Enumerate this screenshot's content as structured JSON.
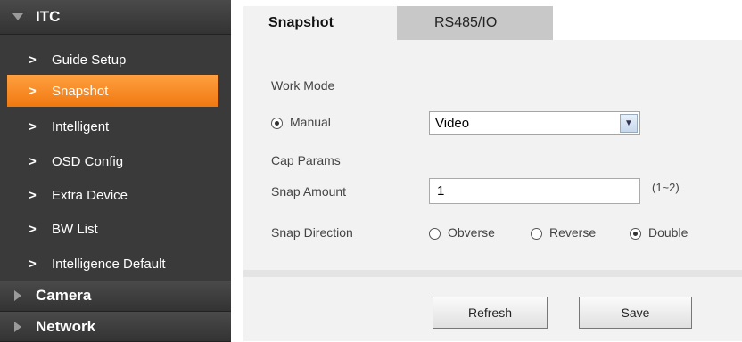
{
  "sidebar": {
    "header": "ITC",
    "items": [
      {
        "label": "Guide Setup"
      },
      {
        "label": "Snapshot",
        "active": true
      },
      {
        "label": "Intelligent"
      },
      {
        "label": "OSD Config"
      },
      {
        "label": "Extra Device"
      },
      {
        "label": "BW List"
      },
      {
        "label": "Intelligence Default"
      }
    ],
    "sections": [
      {
        "label": "Camera"
      },
      {
        "label": "Network"
      }
    ],
    "accent_color": "#f5821f"
  },
  "tabs": [
    {
      "label": "Snapshot",
      "active": true
    },
    {
      "label": "RS485/IO",
      "active": false
    }
  ],
  "form": {
    "work_mode_label": "Work Mode",
    "manual_label": "Manual",
    "mode_value": "Video",
    "cap_params_label": "Cap Params",
    "snap_amount_label": "Snap Amount",
    "snap_amount_value": "1",
    "snap_amount_range": "(1~2)",
    "snap_direction_label": "Snap Direction",
    "direction_options": [
      "Obverse",
      "Reverse",
      "Double"
    ],
    "direction_selected": "Double"
  },
  "buttons": {
    "refresh": "Refresh",
    "save": "Save"
  }
}
